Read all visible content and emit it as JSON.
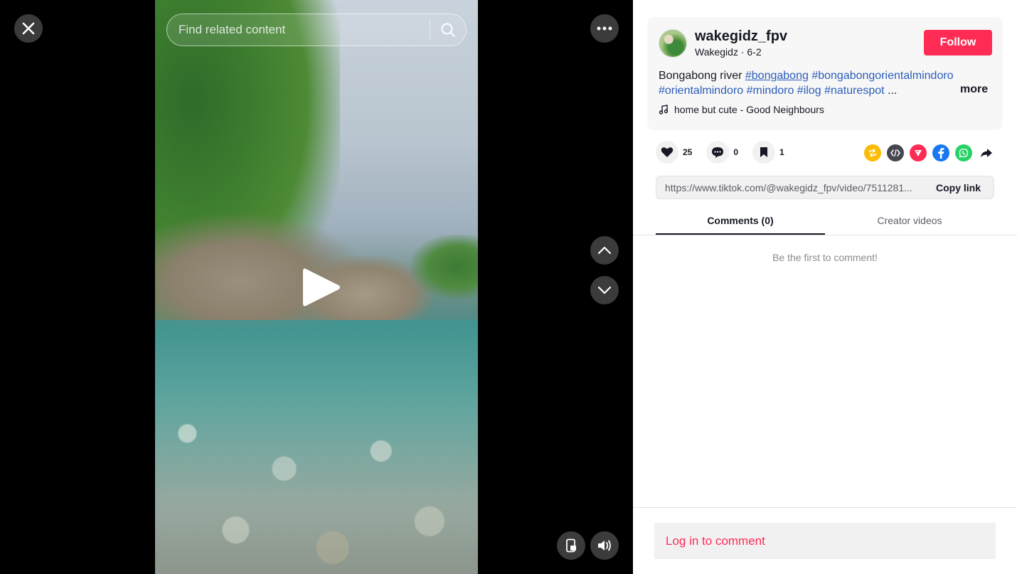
{
  "search": {
    "placeholder": "Find related content"
  },
  "author": {
    "username": "wakegidz_fpv",
    "display_name": "Wakegidz",
    "date": "6-2",
    "follow_label": "Follow"
  },
  "description": {
    "text": "Bongabong river",
    "tags": [
      "#bongabong",
      "#bongabongorientalmindoro",
      "#orientalmindoro",
      "#mindoro",
      "#ilog",
      "#naturespot"
    ],
    "ellipsis": "...",
    "more_label": "more"
  },
  "music": {
    "title": "home but cute - Good Neighbours"
  },
  "stats": {
    "likes": "25",
    "comments": "0",
    "saves": "1"
  },
  "share": {
    "link": "https://www.tiktok.com/@wakegidz_fpv/video/7511281...",
    "copy_label": "Copy link"
  },
  "tabs": [
    {
      "label": "Comments (0)"
    },
    {
      "label": "Creator videos"
    }
  ],
  "comments": {
    "empty_text": "Be the first to comment!"
  },
  "login": {
    "label": "Log in to comment"
  },
  "colors": {
    "accent": "#fe2c55",
    "hashtag": "#2b5db9"
  },
  "icons": [
    "close-icon",
    "more-icon",
    "search-icon",
    "play-icon",
    "chevron-up-icon",
    "chevron-down-icon",
    "phone-icon",
    "volume-icon",
    "music-note-icon",
    "heart-icon",
    "comment-icon",
    "bookmark-icon",
    "repost-icon",
    "embed-icon",
    "send-icon",
    "facebook-icon",
    "whatsapp-icon",
    "share-arrow-icon"
  ]
}
